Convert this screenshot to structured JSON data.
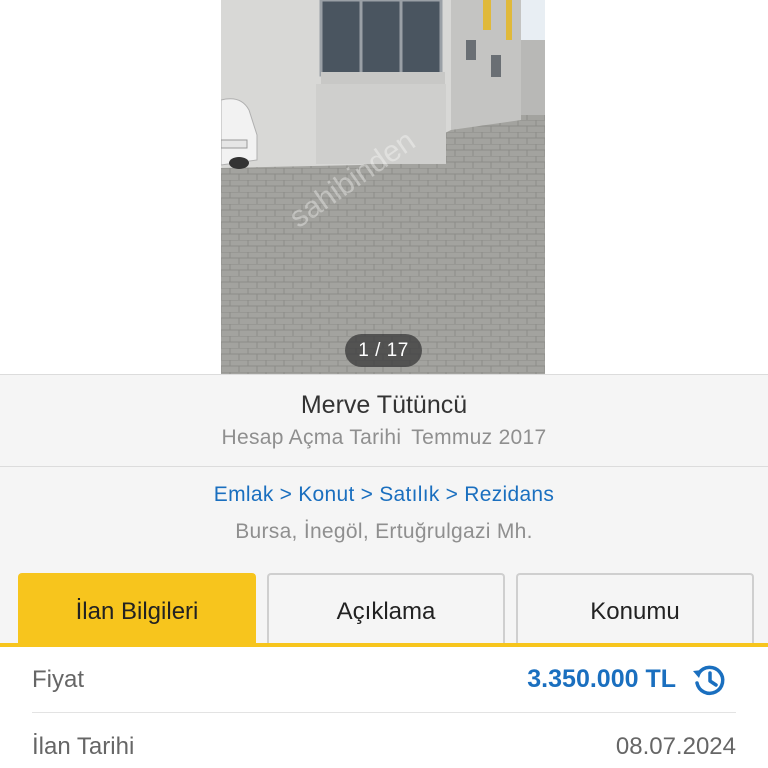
{
  "gallery": {
    "counter": "1 / 17",
    "watermark": "sahibinden"
  },
  "seller": {
    "name": "Merve Tütüncü",
    "since_label": "Hesap Açma Tarihi",
    "since_value": "Temmuz 2017"
  },
  "breadcrumb": {
    "items": [
      "Emlak",
      "Konut",
      "Satılık",
      "Rezidans"
    ],
    "separator": ">"
  },
  "location": "Bursa, İnegöl, Ertuğrulgazi Mh.",
  "tabs": [
    {
      "label": "İlan Bilgileri",
      "active": true
    },
    {
      "label": "Açıklama",
      "active": false
    },
    {
      "label": "Konumu",
      "active": false
    }
  ],
  "details": {
    "price_label": "Fiyat",
    "price_value": "3.350.000 TL",
    "date_label": "İlan Tarihi",
    "date_value": "08.07.2024"
  },
  "icons": {
    "price_history": "history-icon"
  },
  "colors": {
    "accent": "#f7c51d",
    "link": "#1a6fbf",
    "muted": "#8f8f8f"
  }
}
